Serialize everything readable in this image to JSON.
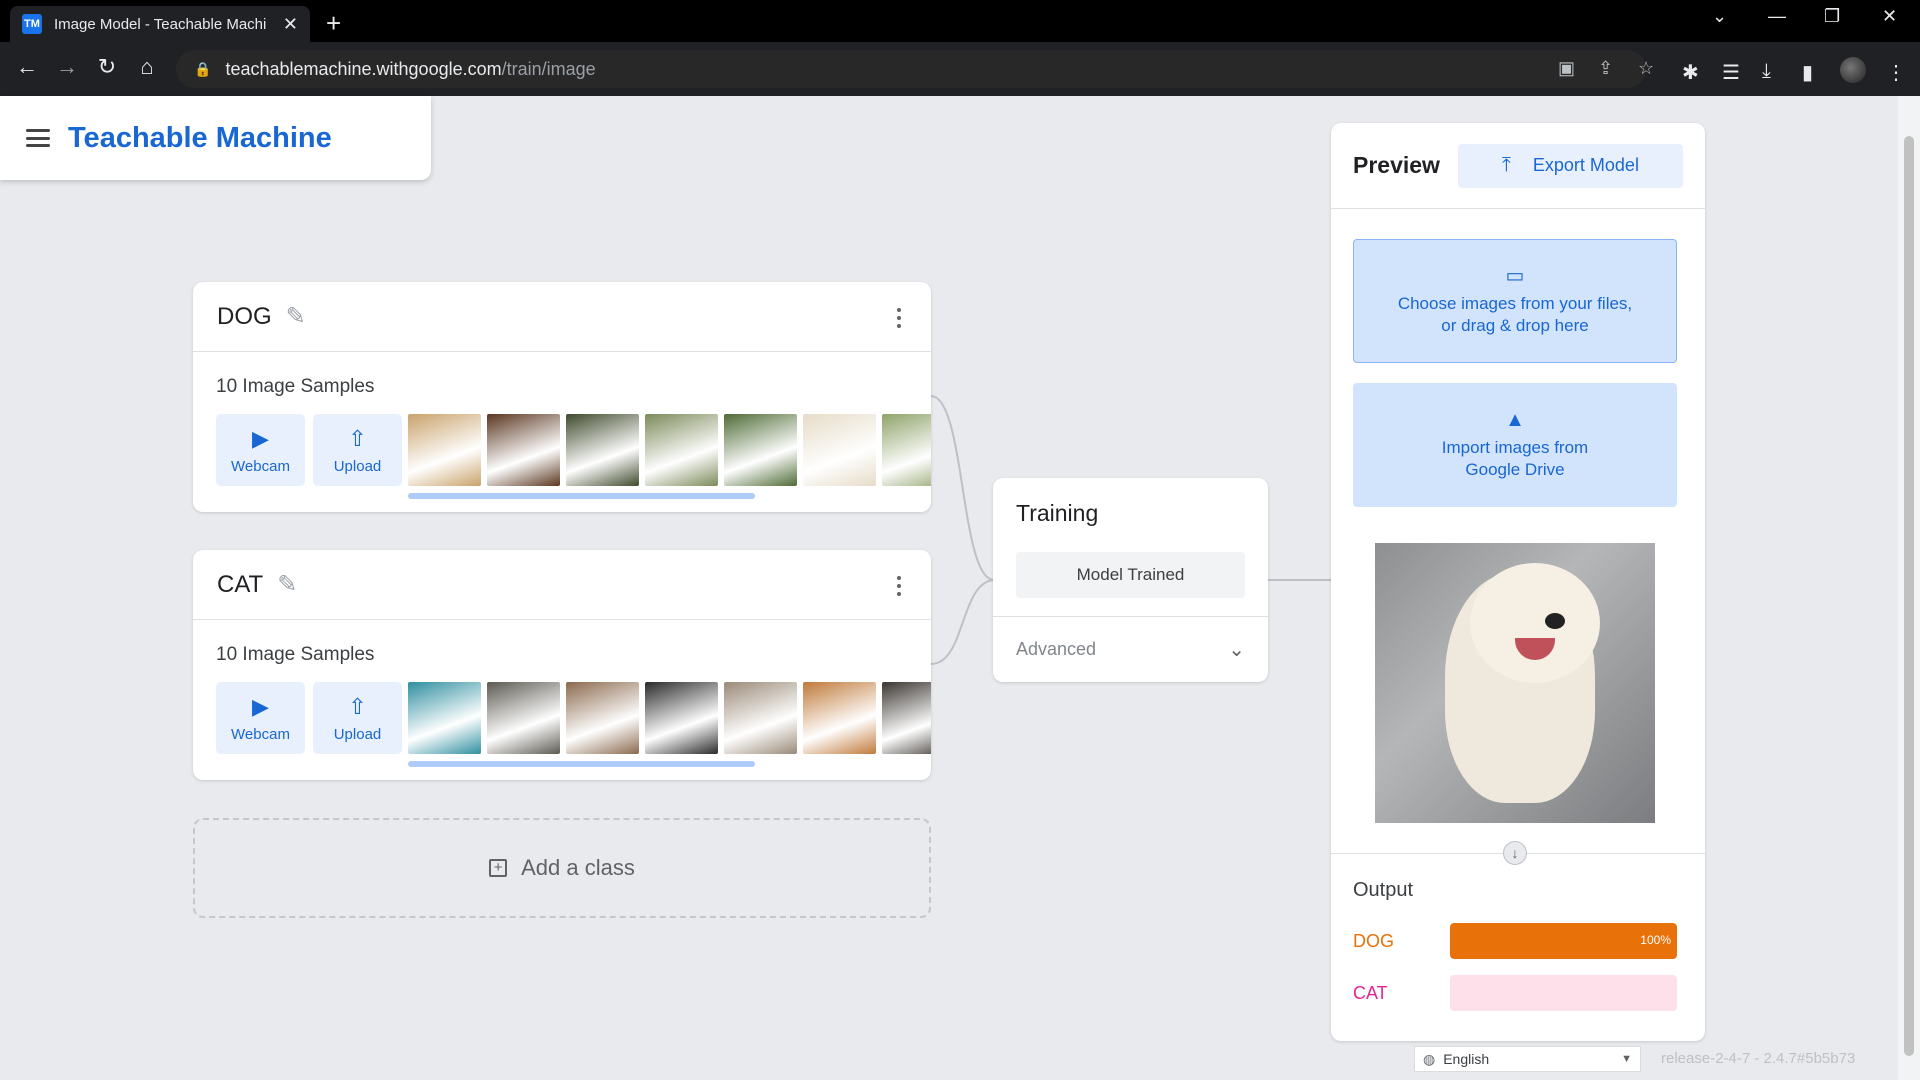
{
  "browser": {
    "tab_title": "Image Model - Teachable Machi",
    "favicon_text": "TM",
    "url_host": "teachablemachine.withgoogle.com",
    "url_path": "/train/image"
  },
  "header": {
    "brand": "Teachable Machine"
  },
  "classes": [
    {
      "name": "DOG",
      "samples_label": "10 Image Samples",
      "webcam_label": "Webcam",
      "upload_label": "Upload",
      "thumb_colors": [
        "#c9a26b",
        "#5a3620",
        "#3f4a2c",
        "#7c8a5a",
        "#4e6b35",
        "#e6dcc8",
        "#8fa36a",
        "#d8c29a"
      ]
    },
    {
      "name": "CAT",
      "samples_label": "10 Image Samples",
      "webcam_label": "Webcam",
      "upload_label": "Upload",
      "thumb_colors": [
        "#2f8fa0",
        "#5c5a52",
        "#8b6a4e",
        "#2a2a2a",
        "#9a8a78",
        "#c07a3a",
        "#3a3530",
        "#b09a86"
      ]
    }
  ],
  "add_class_label": "Add a class",
  "training": {
    "title": "Training",
    "button_label": "Model Trained",
    "advanced_label": "Advanced"
  },
  "preview": {
    "title": "Preview",
    "export_label": "Export Model",
    "choose_files_line1": "Choose images from your files,",
    "choose_files_line2": "or drag & drop here",
    "drive_line1": "Import images from",
    "drive_line2": "Google Drive",
    "output_title": "Output",
    "outputs": [
      {
        "label": "DOG",
        "value": 1.0,
        "pct_text": "100%",
        "color": "#e8710a",
        "track": "#fde7cf"
      },
      {
        "label": "CAT",
        "value": 0.0,
        "pct_text": "",
        "color": "#e52592",
        "track": "#fde0ea"
      }
    ]
  },
  "footer": {
    "language": "English",
    "release": "release-2-4-7 - 2.4.7#5b5b73"
  }
}
